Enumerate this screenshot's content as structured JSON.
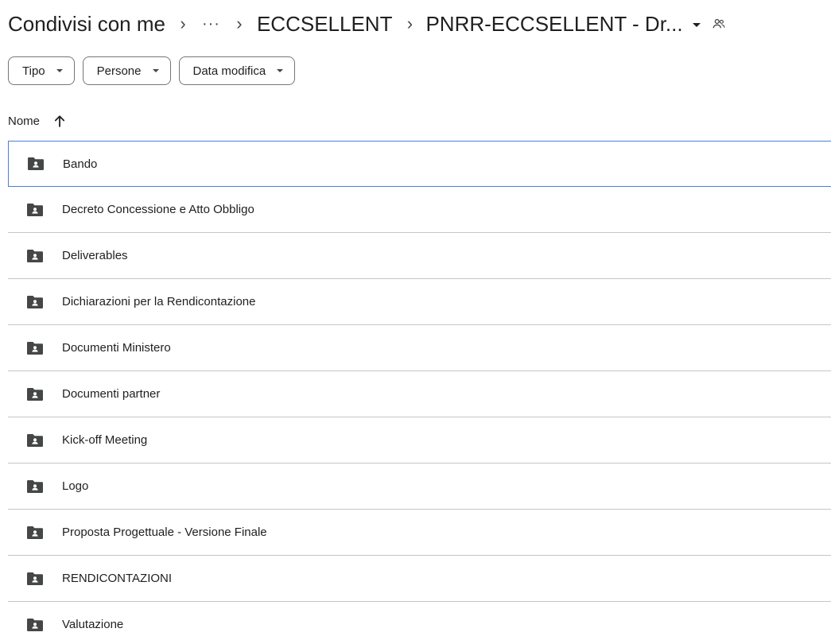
{
  "breadcrumb": {
    "root": "Condivisi con me",
    "more": "···",
    "parent": "ECCSELLENT",
    "current": "PNRR-ECCSELLENT - Dr..."
  },
  "filters": [
    {
      "label": "Tipo"
    },
    {
      "label": "Persone"
    },
    {
      "label": "Data modifica"
    }
  ],
  "list_header": {
    "name_column": "Nome",
    "sort": "ascending"
  },
  "icons": {
    "folder": "shared-folder-icon",
    "share": "people-icon",
    "sort": "arrow-up-icon"
  },
  "colors": {
    "folder_icon": "#444746",
    "selection_border": "#4a7fd6",
    "divider": "#c4c7c5"
  },
  "folders": [
    {
      "name": "Bando",
      "selected": true
    },
    {
      "name": "Decreto Concessione e Atto Obbligo"
    },
    {
      "name": "Deliverables"
    },
    {
      "name": "Dichiarazioni per la Rendicontazione"
    },
    {
      "name": "Documenti Ministero"
    },
    {
      "name": "Documenti partner"
    },
    {
      "name": "Kick-off Meeting"
    },
    {
      "name": "Logo"
    },
    {
      "name": "Proposta Progettuale - Versione Finale"
    },
    {
      "name": "RENDICONTAZIONI"
    },
    {
      "name": "Valutazione"
    }
  ]
}
